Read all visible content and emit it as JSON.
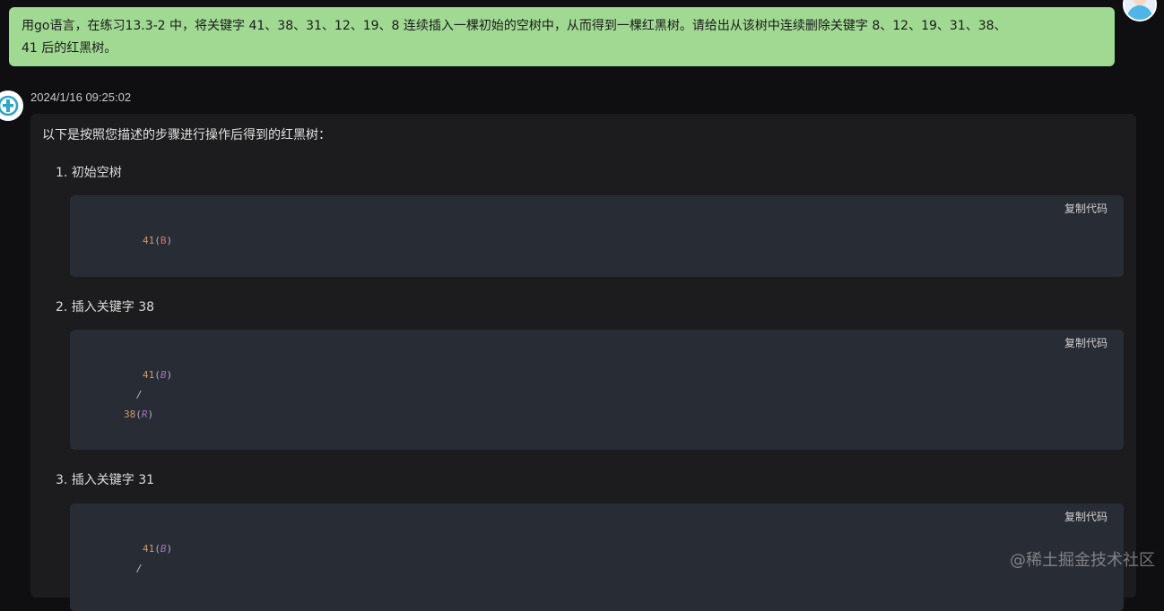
{
  "user_message": {
    "line1": "用go语言，在练习13.3-2 中，将关键字 41、38、31、12、19、8 连续插入一棵初始的空树中，从而得到一棵红黑树。请给出从该树中连续删除关键字 8、12、19、31、38、",
    "line2": "41 后的红黑树。"
  },
  "bot": {
    "avatar_icon": "assistant-logo-icon",
    "timestamp": "2024/1/16 09:25:02",
    "intro": "以下是按照您描述的步骤进行操作后得到的红黑树："
  },
  "steps": [
    {
      "label": "1. 初始空树",
      "copy_label": "复制代码",
      "code": [
        {
          "num": "41",
          "open": "(",
          "tag": "B",
          "close": ")"
        }
      ]
    },
    {
      "label": "2. 插入关键字 38",
      "copy_label": "复制代码",
      "code": [
        {
          "num": "41",
          "open": "(",
          "tag": "B",
          "close": ")"
        },
        {
          "slash": "/"
        },
        {
          "num": "38",
          "open": "(",
          "tag": "R",
          "close": ")"
        }
      ]
    },
    {
      "label": "3. 插入关键字 31",
      "copy_label": "复制代码",
      "code": [
        {
          "num": "41",
          "open": "(",
          "tag": "B",
          "close": ")"
        },
        {
          "slash": "/"
        }
      ]
    }
  ],
  "watermark": "@稀土掘金技术社区",
  "colors": {
    "user_bubble": "#a0d992",
    "page_bg": "#0f0f12",
    "card_bg": "#1c1c1e",
    "code_bg": "#282c34"
  }
}
